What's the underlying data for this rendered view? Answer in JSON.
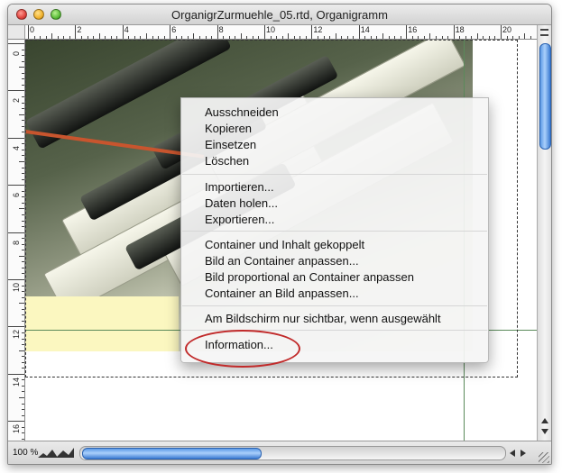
{
  "window": {
    "title": "OrganigrZurmuehle_05.rtd, Organigramm"
  },
  "ruler": {
    "horizontal": [
      "0",
      "2",
      "4",
      "6",
      "8",
      "10",
      "12",
      "14",
      "16",
      "18",
      "20"
    ],
    "vertical": [
      "0",
      "2",
      "4",
      "6",
      "8",
      "10",
      "12",
      "14",
      "16"
    ]
  },
  "context_menu": {
    "groups": [
      [
        "Ausschneiden",
        "Kopieren",
        "Einsetzen",
        "Löschen"
      ],
      [
        "Importieren...",
        "Daten holen...",
        "Exportieren..."
      ],
      [
        "Container und Inhalt gekoppelt",
        "Bild an Container anpassen...",
        "Bild proportional an Container anpassen",
        "Container an Bild anpassen..."
      ],
      [
        "Am Bildschirm nur sichtbar, wenn ausgewählt"
      ],
      [
        "Information..."
      ]
    ]
  },
  "statusbar": {
    "zoom": "100 %"
  },
  "colors": {
    "highlight_ellipse": "#c12a2a",
    "scroll_thumb": "#5d9ae6",
    "guide_line": "#5a8a5a"
  }
}
